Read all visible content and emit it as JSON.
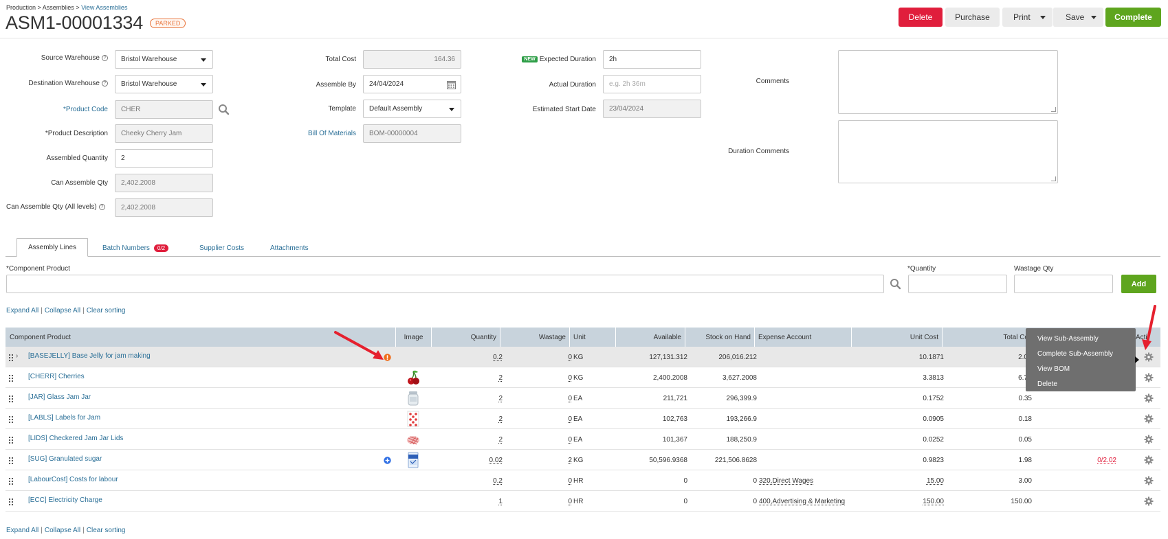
{
  "breadcrumb": {
    "part1": "Production",
    "part2": "Assemblies",
    "part3": "View Assemblies",
    "sep": " > "
  },
  "header": {
    "title": "ASM1-00001334",
    "status": "PARKED"
  },
  "toolbar": {
    "delete": "Delete",
    "purchase": "Purchase",
    "print": "Print",
    "save": "Save",
    "complete": "Complete"
  },
  "form": {
    "source_warehouse": {
      "label": "Source Warehouse",
      "value": "Bristol Warehouse"
    },
    "destination_warehouse": {
      "label": "Destination Warehouse",
      "value": "Bristol Warehouse"
    },
    "product_code": {
      "label": "Product Code",
      "value": "CHER"
    },
    "product_description": {
      "label": "Product Description",
      "value": "Cheeky Cherry Jam"
    },
    "assembled_quantity": {
      "label": "Assembled Quantity",
      "value": "2"
    },
    "can_assemble_qty": {
      "label": "Can Assemble Qty",
      "value": "2,402.2008"
    },
    "can_assemble_all": {
      "label": "Can Assemble Qty (All levels)",
      "value": "2,402.2008"
    },
    "total_cost": {
      "label": "Total Cost",
      "value": "164.36"
    },
    "assemble_by": {
      "label": "Assemble By",
      "value": "24/04/2024"
    },
    "template": {
      "label": "Template",
      "value": "Default Assembly"
    },
    "bill_of_materials": {
      "label": "Bill Of Materials",
      "value": "BOM-00000004"
    },
    "expected_duration": {
      "badge": "NEW",
      "label": "Expected Duration",
      "value": "2h"
    },
    "actual_duration": {
      "label": "Actual Duration",
      "placeholder": "e.g. 2h 36m"
    },
    "estimated_start": {
      "label": "Estimated Start Date",
      "value": "23/04/2024"
    },
    "comments": {
      "label": "Comments"
    },
    "duration_comments": {
      "label": "Duration Comments"
    },
    "required_mark": "*"
  },
  "tabs": [
    {
      "label": "Assembly Lines"
    },
    {
      "label": "Batch Numbers",
      "badge": "0/2"
    },
    {
      "label": "Supplier Costs"
    },
    {
      "label": "Attachments"
    }
  ],
  "add_line": {
    "component_label": "Component Product",
    "quantity_label": "Quantity",
    "wastage_label": "Wastage Qty",
    "add": "Add"
  },
  "links": {
    "expand": "Expand All",
    "collapse": "Collapse All",
    "clear": "Clear sorting",
    "sep": "|"
  },
  "table": {
    "headers": {
      "component": "Component Product",
      "image": "Image",
      "quantity": "Quantity",
      "wastage": "Wastage",
      "unit": "Unit",
      "available": "Available",
      "soh": "Stock on Hand",
      "expense": "Expense Account",
      "unit_cost": "Unit Cost",
      "total_cost": "Total Co",
      "action": "Acti"
    },
    "rows": [
      {
        "product": "[BASEJELLY] Base Jelly for jam making",
        "quantity": "0.2",
        "wastage": "0",
        "unit": "KG",
        "available": "127,131.312",
        "soh": "206,016.212",
        "expense": "",
        "unit_cost": "10.1871",
        "total_cost": "2.0",
        "batch": ""
      },
      {
        "product": "[CHERR] Cherries",
        "quantity": "2",
        "wastage": "0",
        "unit": "KG",
        "available": "2,400.2008",
        "soh": "3,627.2008",
        "expense": "",
        "unit_cost": "3.3813",
        "total_cost": "6.7",
        "batch": ""
      },
      {
        "product": "[JAR] Glass Jam Jar",
        "quantity": "2",
        "wastage": "0",
        "unit": "EA",
        "available": "211,721",
        "soh": "296,399.9",
        "expense": "",
        "unit_cost": "0.1752",
        "total_cost": "0.35",
        "batch": ""
      },
      {
        "product": "[LABLS] Labels for Jam",
        "quantity": "2",
        "wastage": "0",
        "unit": "EA",
        "available": "102,763",
        "soh": "193,266.9",
        "expense": "",
        "unit_cost": "0.0905",
        "total_cost": "0.18",
        "batch": ""
      },
      {
        "product": "[LIDS] Checkered Jam Jar Lids",
        "quantity": "2",
        "wastage": "0",
        "unit": "EA",
        "available": "101,367",
        "soh": "188,250.9",
        "expense": "",
        "unit_cost": "0.0252",
        "total_cost": "0.05",
        "batch": ""
      },
      {
        "product": "[SUG] Granulated sugar",
        "quantity": "0.02",
        "wastage": "2",
        "unit": "KG",
        "available": "50,596.9368",
        "soh": "221,506.8628",
        "expense": "",
        "unit_cost": "0.9823",
        "total_cost": "1.98",
        "batch": "0/2.02"
      },
      {
        "product": "[LabourCost] Costs for labour",
        "quantity": "0.2",
        "wastage": "0",
        "unit": "HR",
        "available": "0",
        "soh": "0",
        "expense": "320,Direct Wages",
        "unit_cost": "15.00",
        "total_cost": "3.00",
        "batch": ""
      },
      {
        "product": "[ECC] Electricity Charge",
        "quantity": "1",
        "wastage": "0",
        "unit": "HR",
        "available": "0",
        "soh": "0",
        "expense": "400,Advertising & Marketing",
        "unit_cost": "150.00",
        "total_cost": "150.00",
        "batch": ""
      }
    ]
  },
  "context_menu": {
    "items": [
      "View Sub-Assembly",
      "Complete Sub-Assembly",
      "View BOM",
      "Delete"
    ]
  },
  "colors": {
    "accent_red": "#e01e3c",
    "accent_green": "#5ea51e",
    "link": "#2a6f97",
    "status_orange": "#e8743b",
    "table_header": "#c8d3dc"
  }
}
